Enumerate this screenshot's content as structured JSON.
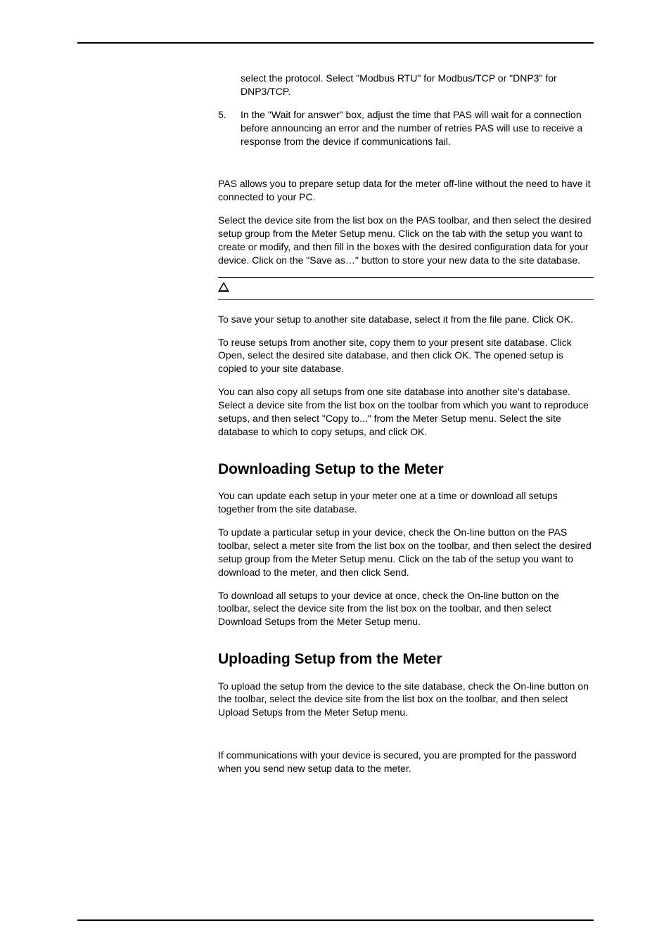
{
  "items": {
    "cont_text": "select the protocol. Select \"Modbus RTU\" for Modbus/TCP or \"DNP3\" for DNP3/TCP.",
    "num5": "5.",
    "num5_text": "In the \"Wait for answer\" box, adjust the time that PAS will wait for a connection before announcing an error and the number of retries PAS will use to receive a response from the device if communications fail."
  },
  "p1": "PAS allows you to prepare setup data for the meter off-line without the need to have it connected to your PC.",
  "p2": "Select the device site from the list box on the PAS toolbar, and then select the desired setup group from the Meter Setup menu. Click on the tab with the setup you want to create or modify, and then fill in the boxes with the desired configuration data for your device.  Click on the \"Save as…\" button to store your new data to the site database.",
  "p3": "To save your setup to another site database, select it from the file pane. Click OK.",
  "p4": "To reuse setups from another site, copy them to your present site database. Click Open, select the desired site database, and then click OK. The opened setup is copied to your site database.",
  "p5": "You can also copy all setups from one site database into another site's database. Select a device site from the list box on the toolbar from which you want to reproduce setups, and then select \"Copy to...\" from the Meter Setup menu. Select the site database to which to copy setups, and click OK.",
  "h_download": "Downloading Setup to the Meter",
  "p6": "You can update each setup in your meter one at a time or download all setups together from the site database.",
  "p7": "To update a particular setup in your device, check the On-line button on the PAS toolbar, select a meter site from the list box on the toolbar, and then select the desired setup group from the Meter Setup menu. Click on the tab of the setup you want to download to the meter, and then click Send.",
  "p8": "To download all setups to your device at once, check the On-line button on the toolbar, select the device site from the list box on the toolbar, and then select Download Setups from the Meter Setup menu.",
  "h_upload": "Uploading Setup from the Meter",
  "p9": "To upload the setup from the device to the site database, check the On-line button  on the toolbar, select the device site from the list box on the toolbar, and then select Upload Setups from the Meter Setup menu.",
  "p10": "If communications with your device is secured, you are prompted for the password when you send new setup data to the meter."
}
